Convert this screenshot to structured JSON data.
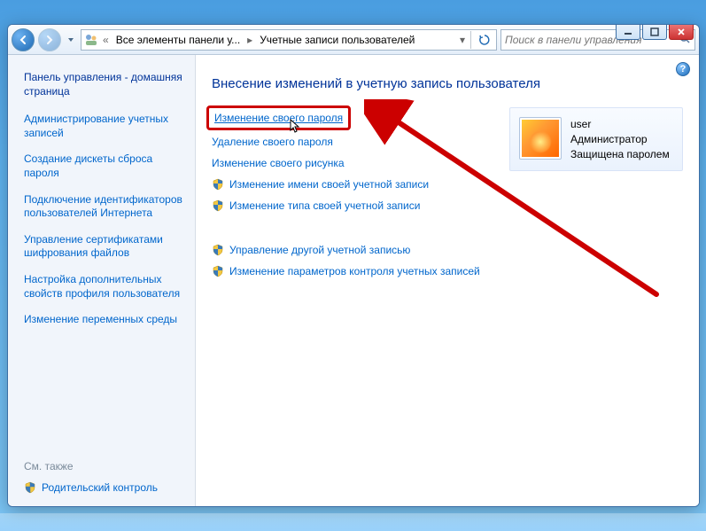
{
  "titlebar": {
    "min_tip": "Свернуть",
    "max_tip": "Развернуть",
    "close_tip": "Закрыть"
  },
  "breadcrumb": {
    "segment1": "Все элементы панели у...",
    "segment2": "Учетные записи пользователей"
  },
  "search": {
    "placeholder": "Поиск в панели управления"
  },
  "sidebar": {
    "heading": "Панель управления - домашняя страница",
    "links": [
      "Администрирование учетных записей",
      "Создание дискеты сброса пароля",
      "Подключение идентификаторов пользователей Интернета",
      "Управление сертификатами шифрования файлов",
      "Настройка дополнительных свойств профиля пользователя",
      "Изменение переменных среды"
    ],
    "see_also": "См. также",
    "parental": "Родительский контроль"
  },
  "content": {
    "title": "Внесение изменений в учетную запись пользователя",
    "actions_plain": [
      "Изменение своего пароля",
      "Удаление своего пароля",
      "Изменение своего рисунка"
    ],
    "actions_shield": [
      "Изменение имени своей учетной записи",
      "Изменение типа своей учетной записи"
    ],
    "actions_shield2": [
      "Управление другой учетной записью",
      "Изменение параметров контроля учетных записей"
    ]
  },
  "user": {
    "name": "user",
    "role": "Администратор",
    "status": "Защищена паролем"
  }
}
